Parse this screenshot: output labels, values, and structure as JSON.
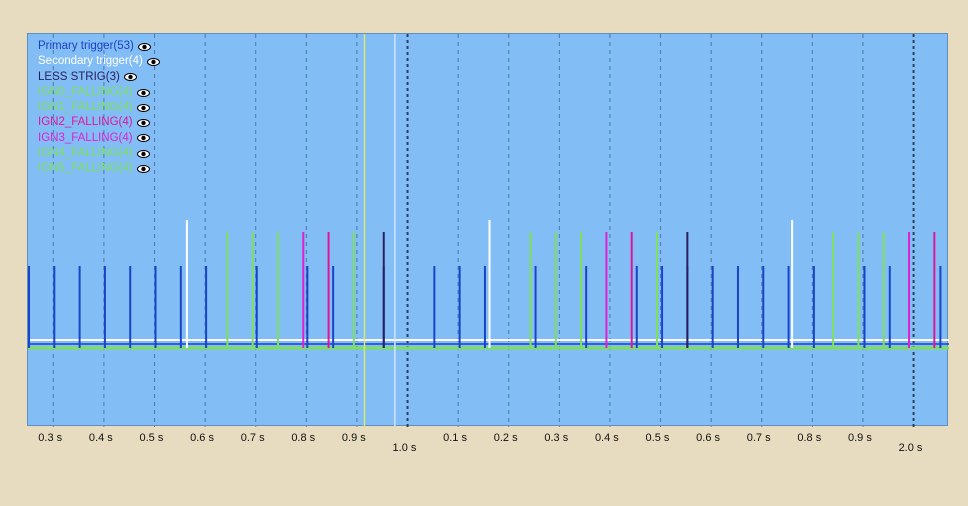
{
  "legend": [
    {
      "label": "Primary trigger(53)",
      "color": "#1a44c8",
      "icon": "eye-icon"
    },
    {
      "label": "Secondary trigger(4)",
      "color": "#ffffff",
      "icon": "eye-icon"
    },
    {
      "label": "LESS STRIG(3)",
      "color": "#2a2060",
      "icon": "eye-icon"
    },
    {
      "label": "IGN0_FALLING(4)",
      "color": "#7ee05a",
      "icon": "eye-icon"
    },
    {
      "label": "IGN1_FALLING(4)",
      "color": "#7ee05a",
      "icon": "eye-icon"
    },
    {
      "label": "IGN2_FALLING(4)",
      "color": "#e0169a",
      "icon": "eye-icon"
    },
    {
      "label": "IGN3_FALLING(4)",
      "color": "#e020d0",
      "icon": "eye-icon"
    },
    {
      "label": "IGN4_FALLING(4)",
      "color": "#7ee05a",
      "icon": "eye-icon"
    },
    {
      "label": "IGN5_FALLING(4)",
      "color": "#7ee05a",
      "icon": "eye-icon"
    }
  ],
  "axis": {
    "minor_labels": [
      "0.3 s",
      "0.4 s",
      "0.5 s",
      "0.6 s",
      "0.7 s",
      "0.8 s",
      "0.9 s",
      "0.1 s",
      "0.2 s",
      "0.3 s",
      "0.4 s",
      "0.5 s",
      "0.6 s",
      "0.7 s",
      "0.8 s",
      "0.9 s"
    ],
    "minor_times": [
      0.3,
      0.4,
      0.5,
      0.6,
      0.7,
      0.8,
      0.9,
      1.1,
      1.2,
      1.3,
      1.4,
      1.5,
      1.6,
      1.7,
      1.8,
      1.9
    ],
    "major_labels": [
      "1.0 s",
      "2.0 s"
    ],
    "major_times": [
      1.0,
      2.0
    ],
    "range": [
      0.25,
      2.07
    ]
  },
  "cursors": [
    {
      "time": 0.915,
      "color": "#d8e870"
    },
    {
      "time": 0.975,
      "color": "#d0e4ff"
    }
  ],
  "chart_data": {
    "type": "line",
    "title": "",
    "xlabel": "",
    "ylabel": "",
    "x_range": [
      0.25,
      2.07
    ],
    "series": [
      {
        "name": "Primary trigger(53)",
        "color": "#1a44c8",
        "level": "low",
        "times": [
          0.252,
          0.302,
          0.352,
          0.402,
          0.452,
          0.502,
          0.552,
          0.602,
          0.702,
          0.802,
          0.853,
          0.953,
          1.053,
          1.103,
          1.153,
          1.253,
          1.353,
          1.453,
          1.503,
          1.553,
          1.603,
          1.653,
          1.703,
          1.753,
          1.803,
          1.903,
          1.953,
          2.053
        ]
      },
      {
        "name": "Secondary trigger(4)",
        "color": "#ffffff",
        "level": "high",
        "times": [
          0.564,
          1.162,
          1.76
        ]
      },
      {
        "name": "LESS STRIG(3)",
        "color": "#2a2060",
        "level": "mid",
        "times": [
          0.953,
          1.553
        ]
      },
      {
        "name": "IGN0_FALLING(4)",
        "color": "#7ee05a",
        "level": "mid",
        "times": [
          0.644,
          1.243,
          1.841
        ]
      },
      {
        "name": "IGN1_FALLING(4)",
        "color": "#7ee05a",
        "level": "mid",
        "times": [
          0.694,
          1.293,
          1.891
        ]
      },
      {
        "name": "IGN2_FALLING(4)",
        "color": "#e0169a",
        "level": "mid",
        "times": [
          0.844,
          1.443,
          2.041
        ]
      },
      {
        "name": "IGN3_FALLING(4)",
        "color": "#e020d0",
        "level": "mid",
        "times": [
          0.794,
          1.393,
          1.991
        ]
      },
      {
        "name": "IGN4_FALLING(4)",
        "color": "#7ee05a",
        "level": "mid",
        "times": [
          0.744,
          1.343,
          1.941
        ]
      },
      {
        "name": "IGN5_FALLING(4)",
        "color": "#7ee05a",
        "level": "mid",
        "times": [
          0.894,
          1.493
        ]
      }
    ]
  }
}
